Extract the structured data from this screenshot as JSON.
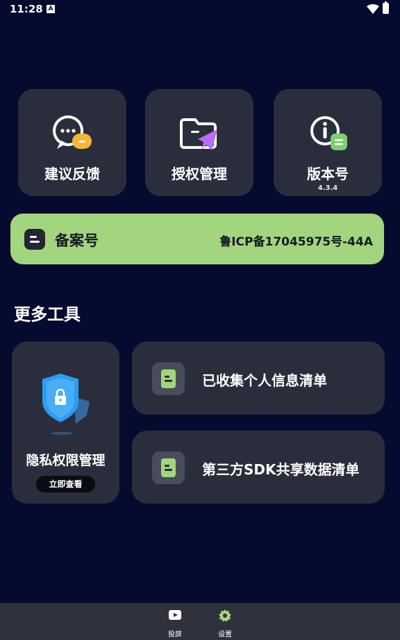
{
  "status_bar": {
    "time": "11:28",
    "app_glyph": "A"
  },
  "top_cards": [
    {
      "label": "建议反馈",
      "icon": "feedback-icon"
    },
    {
      "label": "授权管理",
      "icon": "authorization-icon"
    },
    {
      "label": "版本号",
      "icon": "version-info-icon",
      "version": "4.3.4"
    }
  ],
  "record": {
    "label": "备案号",
    "value": "鲁ICP备17045975号-44A"
  },
  "section_title": "更多工具",
  "privacy": {
    "label": "隐私权限管理",
    "button": "立即查看"
  },
  "list_items": [
    {
      "label": "已收集个人信息清单"
    },
    {
      "label": "第三方SDK共享数据清单"
    }
  ],
  "bottom_nav": [
    {
      "label": "投屏",
      "icon": "cast-icon"
    },
    {
      "label": "设置",
      "icon": "settings-icon",
      "active": true
    }
  ],
  "colors": {
    "background": "#050b2e",
    "card": "#2a2e3c",
    "accent": "#a3d57e",
    "nav": "#2f323d"
  }
}
